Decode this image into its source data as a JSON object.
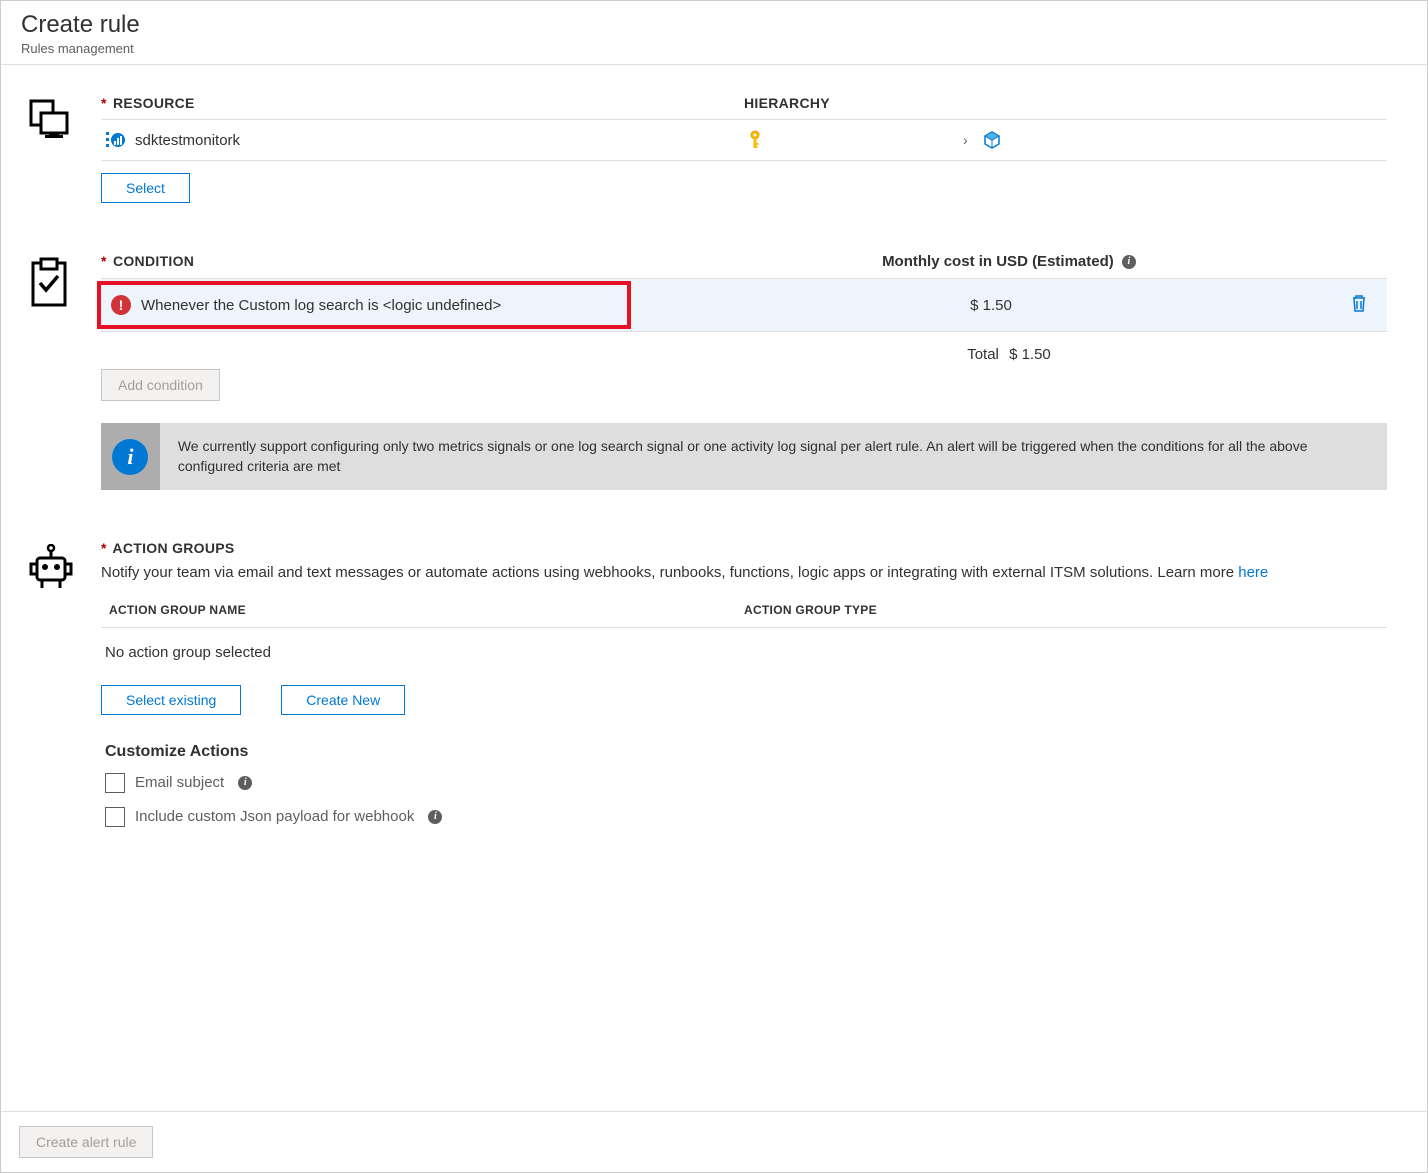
{
  "header": {
    "title": "Create rule",
    "subtitle": "Rules management"
  },
  "resource": {
    "label_resource": "RESOURCE",
    "label_hierarchy": "HIERARCHY",
    "name": "sdktestmonitork",
    "select_button": "Select"
  },
  "condition": {
    "label": "CONDITION",
    "cost_header": "Monthly cost in USD (Estimated)",
    "item_text": "Whenever the Custom log search is <logic undefined>",
    "cost_value": "$ 1.50",
    "total_label": "Total",
    "total_value": "$ 1.50",
    "add_button": "Add condition",
    "info_text": "We currently support configuring only two metrics signals or one log search signal or one activity log signal per alert rule. An alert will be triggered when the conditions for all the above configured criteria are met"
  },
  "action_groups": {
    "label": "ACTION GROUPS",
    "description_prefix": "Notify your team via email and text messages or automate actions using webhooks, runbooks, functions, logic apps or integrating with external ITSM solutions. Learn more ",
    "description_link": "here",
    "col_name": "ACTION GROUP NAME",
    "col_type": "ACTION GROUP TYPE",
    "empty_text": "No action group selected",
    "select_existing": "Select existing",
    "create_new": "Create New",
    "customize_title": "Customize Actions",
    "checkbox_email": "Email subject",
    "checkbox_json": "Include custom Json payload for webhook"
  },
  "footer": {
    "create_button": "Create alert rule"
  }
}
